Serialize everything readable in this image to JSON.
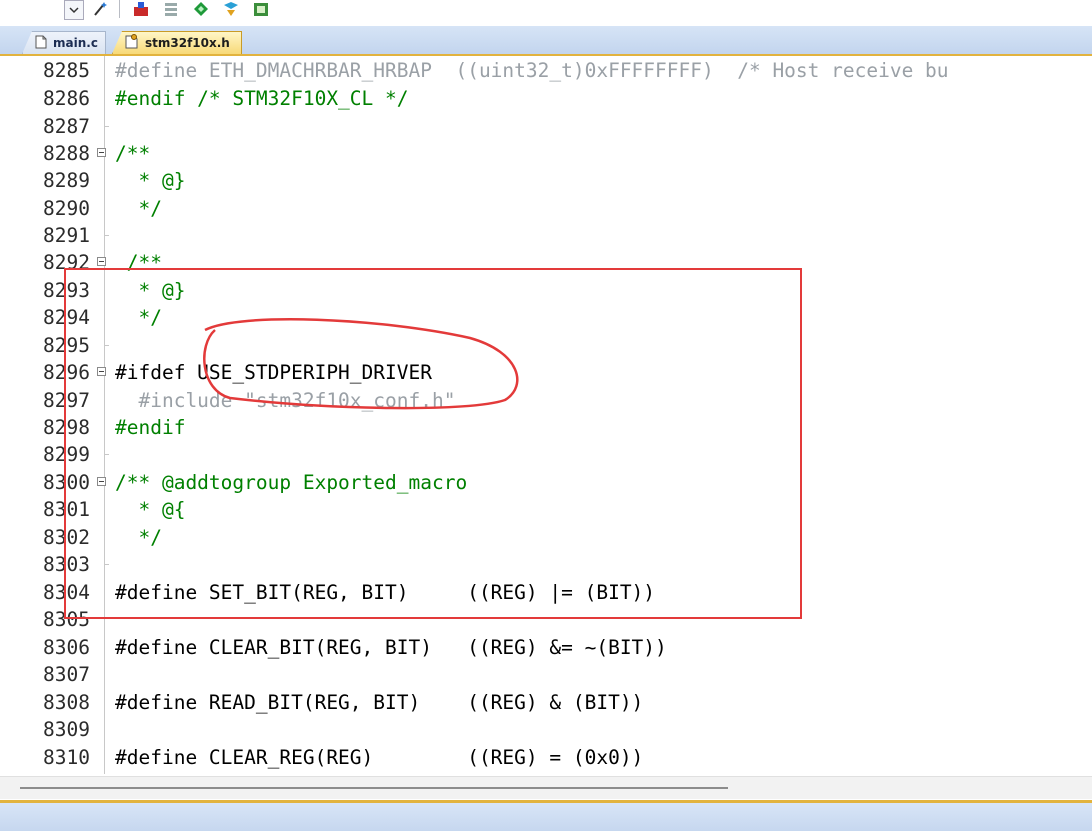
{
  "toolbar": {
    "buttons": [
      {
        "icon": "chevron-down-icon"
      },
      {
        "icon": "magic-wand-icon"
      },
      {
        "icon": "load-icon"
      },
      {
        "icon": "layers-icon"
      },
      {
        "icon": "diamond-icon"
      },
      {
        "icon": "debug-icon"
      },
      {
        "icon": "chip-icon"
      }
    ]
  },
  "tabs": [
    {
      "label": "main.c",
      "icon": "file-icon",
      "active": false
    },
    {
      "label": "stm32f10x.h",
      "icon": "header-file-icon",
      "active": true
    }
  ],
  "colors": {
    "preprocessor": "#008000",
    "comment": "#008000",
    "code": "#000080",
    "hex": "#1c8f8f",
    "annotation": "#e33a3a",
    "tab_active": "#f7d978"
  },
  "lines": [
    {
      "num": "8285",
      "text": "#define ETH_DMACHRBAR_HRBAP  ((uint32_t)0xFFFFFFFF)  /* Host receive bu"
    },
    {
      "num": "8286",
      "text": "#endif /* STM32F10X_CL */"
    },
    {
      "num": "8287",
      "text": ""
    },
    {
      "num": "8288",
      "text": "/**"
    },
    {
      "num": "8289",
      "text": "  * @}"
    },
    {
      "num": "8290",
      "text": "  */"
    },
    {
      "num": "8291",
      "text": ""
    },
    {
      "num": "8292",
      "text": " /**"
    },
    {
      "num": "8293",
      "text": "  * @}"
    },
    {
      "num": "8294",
      "text": "  */"
    },
    {
      "num": "8295",
      "text": ""
    },
    {
      "num": "8296",
      "text": "#ifdef USE_STDPERIPH_DRIVER"
    },
    {
      "num": "8297",
      "text": "  #include \"stm32f10x_conf.h\""
    },
    {
      "num": "8298",
      "text": "#endif"
    },
    {
      "num": "8299",
      "text": ""
    },
    {
      "num": "8300",
      "text": "/** @addtogroup Exported_macro"
    },
    {
      "num": "8301",
      "text": "  * @{"
    },
    {
      "num": "8302",
      "text": "  */"
    },
    {
      "num": "8303",
      "text": ""
    },
    {
      "num": "8304",
      "text": "#define SET_BIT(REG, BIT)     ((REG) |= (BIT))"
    },
    {
      "num": "8305",
      "text": ""
    },
    {
      "num": "8306",
      "text": "#define CLEAR_BIT(REG, BIT)   ((REG) &= ~(BIT))"
    },
    {
      "num": "8307",
      "text": ""
    },
    {
      "num": "8308",
      "text": "#define READ_BIT(REG, BIT)    ((REG) & (BIT))"
    },
    {
      "num": "8309",
      "text": ""
    },
    {
      "num": "8310",
      "text": "#define CLEAR_REG(REG)        ((REG) = (0x0))"
    }
  ]
}
